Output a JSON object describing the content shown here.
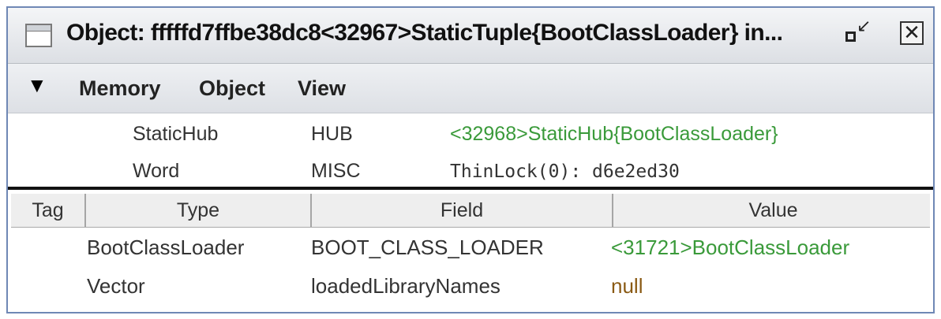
{
  "window": {
    "title": "Object: fffffd7ffbe38dc8<32967>StaticTuple{BootClassLoader} in...",
    "minimize_glyph": "↙",
    "close_glyph": "✕"
  },
  "menu": {
    "arrow": "▼",
    "items": [
      "Memory",
      "Object",
      "View"
    ]
  },
  "header_rows": [
    {
      "name": "StaticHub",
      "kind": "HUB",
      "value": "<32968>StaticHub{BootClassLoader}"
    },
    {
      "name": "Word",
      "kind": "MISC",
      "value": "ThinLock(0): d6e2ed30"
    }
  ],
  "table": {
    "columns": [
      "Tag",
      "Type",
      "Field",
      "Value"
    ],
    "rows": [
      {
        "tag": "",
        "type": "BootClassLoader",
        "field": "BOOT_CLASS_LOADER",
        "value": "<31721>BootClassLoader"
      },
      {
        "tag": "",
        "type": "Vector",
        "field": "loadedLibraryNames",
        "value": "null"
      }
    ]
  },
  "colors": {
    "reference": "#3a9a3a",
    "null": "#8a5a14",
    "frame": "#6f88b5"
  }
}
